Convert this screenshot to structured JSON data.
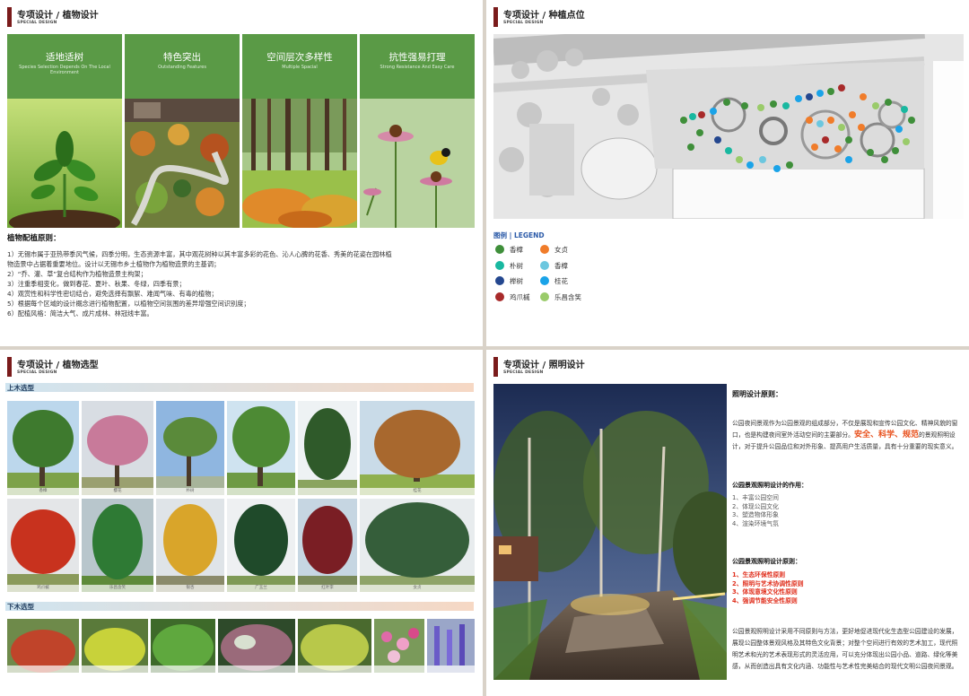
{
  "panels": {
    "p1": {
      "header": {
        "title": "专项设计 / 植物设计",
        "sub": "SPECIAL DESIGN"
      },
      "cards": [
        {
          "title": "适地适树",
          "sub": "Species Selection Depends On The Local Environment"
        },
        {
          "title": "特色突出",
          "sub": "Outstanding Features"
        },
        {
          "title": "空间层次多样性",
          "sub": "Multiple Spacial"
        },
        {
          "title": "抗性强易打理",
          "sub": "Strong Resistance And Easy Care"
        }
      ],
      "section_title": "植物配植原则：",
      "principles": [
        "1）无锡市属于亚热带季风气候，四季分明，生态资源丰富，其中观花树种以其丰富多彩的花色、沁人心脾的花香、秀美的花姿在园林植",
        "物造景中占据着重要地位。设计以无锡市乡土植物作为植物造景的主基调；",
        "2）“乔、灌、草”复合结构作为植物造景主构架；",
        "3）注重季相变化，做到春花、夏叶、秋果、冬绿，四季有景；",
        "4）观赏性和科学性密切结合，避免选择有飘絮、难闻气味、有毒的植物；",
        "5）根据每个区域的设计概念进行植物配置，以植物空间氛围的差异增强空间识别度；",
        "6）配植风格：简洁大气、成片成林、林冠线丰富。"
      ]
    },
    "p2": {
      "header": {
        "title": "专项设计 / 种植点位",
        "sub": "SPECIAL DESIGN"
      },
      "legend_title": "图例 | LEGEND",
      "legend": [
        {
          "label": "香樟",
          "color": "#3f8f3a"
        },
        {
          "label": "女贞",
          "color": "#f07c2a"
        },
        {
          "label": "朴树",
          "color": "#19b8a0"
        },
        {
          "label": "香樟",
          "color": "#6cc7df"
        },
        {
          "label": "榉树",
          "color": "#24478f"
        },
        {
          "label": "桂花",
          "color": "#1aa3e8"
        },
        {
          "label": "鸡爪槭",
          "color": "#a82a2a"
        },
        {
          "label": "乐昌含笑",
          "color": "#9acb6a"
        }
      ]
    },
    "p3": {
      "header": {
        "title": "专项设计 / 植物选型",
        "sub": "SPECIAL DESIGN"
      },
      "upper_label": "上木选型",
      "lower_label": "下木选型",
      "upper_row1": [
        "香樟",
        "樱花",
        "朴树",
        "",
        "",
        "桂花"
      ],
      "upper_row2": [
        "鸡爪槭",
        "乐昌含笑",
        "银杏",
        "广玉兰",
        "红叶李",
        "女贞"
      ],
      "lower_row": [
        "",
        "",
        "",
        "",
        "",
        "",
        ""
      ]
    },
    "p4": {
      "header": {
        "title": "专项设计 / 照明设计",
        "sub": "SPECIAL DESIGN"
      },
      "section_title": "照明设计原则：",
      "intro_a": "公园夜间景观作为公园景观的组成部分，不仅是展现和宣传公园文化、精神风貌的窗口，也是构建夜间室外活动空间的主要部分。",
      "intro_hl": "安全、科学、规范",
      "intro_b": "的景观照明设计，对于提升公园品位和对外形象、提高用户生活质量，具有十分重要的现实意义。",
      "role_title": "公园景观照明设计的作用：",
      "roles": [
        "1、丰富公园空间",
        "2、体现公园文化",
        "3、塑造物体形象",
        "4、渲染环境气氛"
      ],
      "principle_title": "公园景观照明设计原则：",
      "principles": [
        "1、生态环保性原则",
        "2、照明与艺术协调性原则",
        "3、体现意境文化性原则",
        "4、强调节能安全性原则"
      ],
      "closing": "公园景观照明设计采用不同原则与方法，更好地促进现代化生态型公园建设的发展，展现公园整体景观风格及其特色文化背景；对整个空间进行有效的艺术加工，现代照明艺术和光的艺术表现形式的灵活应用，可以充分体现出公园小品、道路、绿化等美感，从而创造出具有文化内涵、功能性与艺术性完美结合的现代文明公园夜间景观。"
    }
  }
}
